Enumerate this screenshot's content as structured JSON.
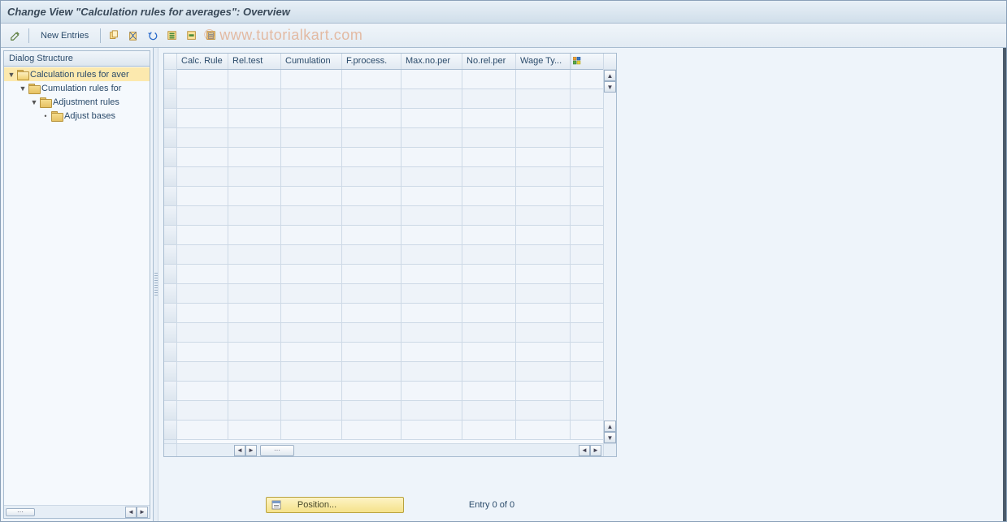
{
  "title": "Change View \"Calculation rules for averages\": Overview",
  "watermark": "© www.tutorialkart.com",
  "toolbar": {
    "new_entries_label": "New Entries"
  },
  "tree": {
    "header": "Dialog Structure",
    "items": [
      {
        "label": "Calculation rules for aver",
        "level": 0,
        "expanded": true,
        "selected": true,
        "open_folder": true,
        "leaf": false
      },
      {
        "label": "Cumulation rules for",
        "level": 1,
        "expanded": true,
        "selected": false,
        "open_folder": false,
        "leaf": false
      },
      {
        "label": "Adjustment rules",
        "level": 2,
        "expanded": true,
        "selected": false,
        "open_folder": false,
        "leaf": false
      },
      {
        "label": "Adjust bases",
        "level": 3,
        "expanded": false,
        "selected": false,
        "open_folder": false,
        "leaf": true
      }
    ]
  },
  "table": {
    "columns": [
      "Calc. Rule",
      "Rel.test",
      "Cumulation",
      "F.process.",
      "Max.no.per",
      "No.rel.per",
      "Wage Ty..."
    ],
    "row_count": 19
  },
  "footer": {
    "position_label": "Position...",
    "entry_text": "Entry 0 of 0"
  }
}
